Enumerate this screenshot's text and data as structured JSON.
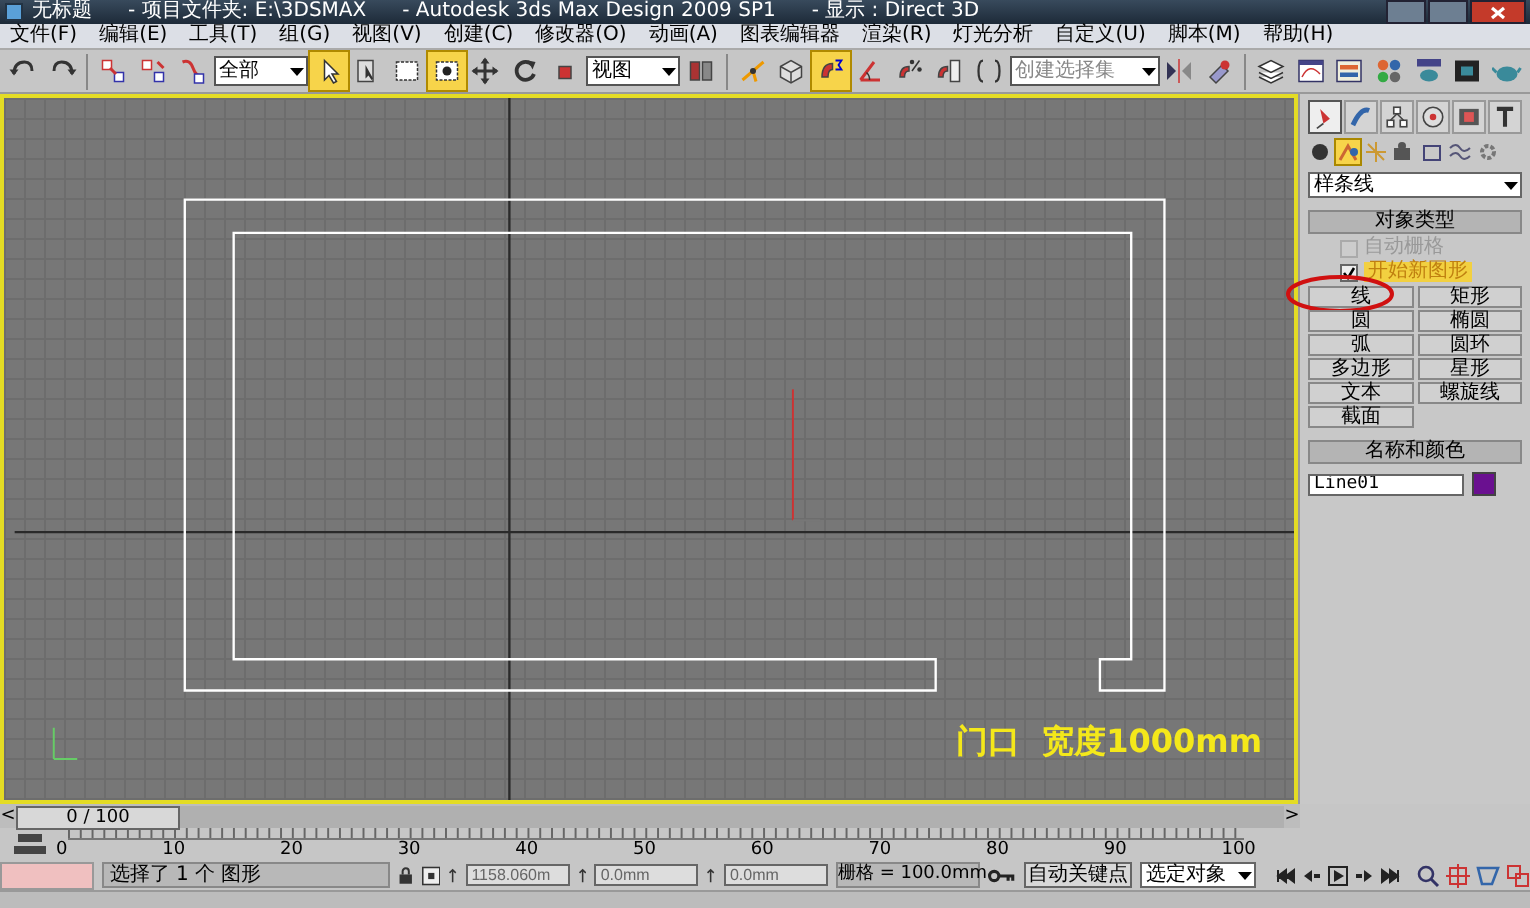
{
  "window": {
    "title": "无标题",
    "project": "- 项目文件夹: E:\\3DSMAX",
    "app": "- Autodesk 3ds Max Design 2009 SP1",
    "display": "- 显示 : Direct 3D"
  },
  "menu": [
    "文件(F)",
    "编辑(E)",
    "工具(T)",
    "组(G)",
    "视图(V)",
    "创建(C)",
    "修改器(O)",
    "动画(A)",
    "图表编辑器",
    "渲染(R)",
    "灯光分析",
    "自定义(U)",
    "脚本(M)",
    "帮助(H)"
  ],
  "toolbar": [
    {
      "kind": "tool",
      "selected": false
    },
    {
      "kind": "tool",
      "selected": false
    },
    {
      "kind": "sep"
    },
    {
      "kind": "tool",
      "selected": false
    },
    {
      "kind": "tool",
      "selected": false
    },
    {
      "kind": "tool",
      "selected": false
    },
    {
      "kind": "dropdown",
      "value": "全部"
    },
    {
      "kind": "tool",
      "selected": true
    },
    {
      "kind": "tool",
      "selected": false
    },
    {
      "kind": "tool",
      "selected": false
    },
    {
      "kind": "tool",
      "selected": true
    },
    {
      "kind": "tool",
      "selected": false
    },
    {
      "kind": "tool",
      "selected": false
    },
    {
      "kind": "tool",
      "selected": false
    },
    {
      "kind": "dropdown",
      "value": "视图"
    },
    {
      "kind": "tool",
      "selected": false
    },
    {
      "kind": "sep"
    },
    {
      "kind": "tool",
      "selected": false
    },
    {
      "kind": "tool",
      "selected": false
    },
    {
      "kind": "tool",
      "selected": true
    },
    {
      "kind": "tool",
      "selected": false
    },
    {
      "kind": "tool",
      "selected": false
    },
    {
      "kind": "tool",
      "selected": false
    },
    {
      "kind": "tool",
      "selected": false
    },
    {
      "kind": "dropdown",
      "placeholder": "创建选择集"
    },
    {
      "kind": "tool",
      "selected": false
    },
    {
      "kind": "tool",
      "selected": false
    },
    {
      "kind": "sep"
    },
    {
      "kind": "tool",
      "selected": false
    },
    {
      "kind": "tool",
      "selected": false
    },
    {
      "kind": "tool",
      "selected": false
    },
    {
      "kind": "tool",
      "selected": false
    },
    {
      "kind": "tool",
      "selected": false
    },
    {
      "kind": "tool",
      "selected": false
    },
    {
      "kind": "tool",
      "selected": false
    }
  ],
  "viewport": {
    "annotation": "门口  宽度1000mm"
  },
  "command_panel": {
    "tabs": [
      {
        "selected": true
      },
      {
        "selected": false
      },
      {
        "selected": false
      },
      {
        "selected": false
      },
      {
        "selected": false
      },
      {
        "selected": false
      }
    ],
    "categories": [
      {
        "selected": false
      },
      {
        "selected": true
      },
      {
        "selected": false
      },
      {
        "selected": false
      },
      {
        "selected": false
      },
      {
        "selected": false
      },
      {
        "selected": false
      }
    ],
    "type_dropdown": "样条线",
    "object_type": {
      "title": "对象类型",
      "auto_grid": {
        "label": "自动栅格",
        "checked": false,
        "disabled": true
      },
      "start_new_shape": {
        "label": "开始新图形",
        "checked": true
      },
      "buttons": [
        {
          "label": "线",
          "circled": true
        },
        {
          "label": "矩形",
          "circled": false
        },
        {
          "label": "圆",
          "circled": false
        },
        {
          "label": "椭圆",
          "circled": false
        },
        {
          "label": "弧",
          "circled": false
        },
        {
          "label": "圆环",
          "circled": false
        },
        {
          "label": "多边形",
          "circled": false
        },
        {
          "label": "星形",
          "circled": false
        },
        {
          "label": "文本",
          "circled": false
        },
        {
          "label": "螺旋线",
          "circled": false
        },
        {
          "label": "截面",
          "circled": false
        }
      ]
    },
    "name_color": {
      "title": "名称和颜色",
      "name": "Line01",
      "color": "#6a1090"
    }
  },
  "time_slider": {
    "prev": "<",
    "label": "0 / 100",
    "next": ">",
    "level": 0
  },
  "ruler": {
    "labels": [
      "0",
      "10",
      "20",
      "30",
      "40",
      "50",
      "60",
      "70",
      "80",
      "90",
      "100"
    ]
  },
  "status": {
    "prompt": "选择了 1 个 图形",
    "x": "1158.060m",
    "y": "0.0mm",
    "z": "0.0mm",
    "grid": "栅格 = 100.0mm",
    "auto_key": "自动关键点",
    "key_mode": "选定对象"
  }
}
